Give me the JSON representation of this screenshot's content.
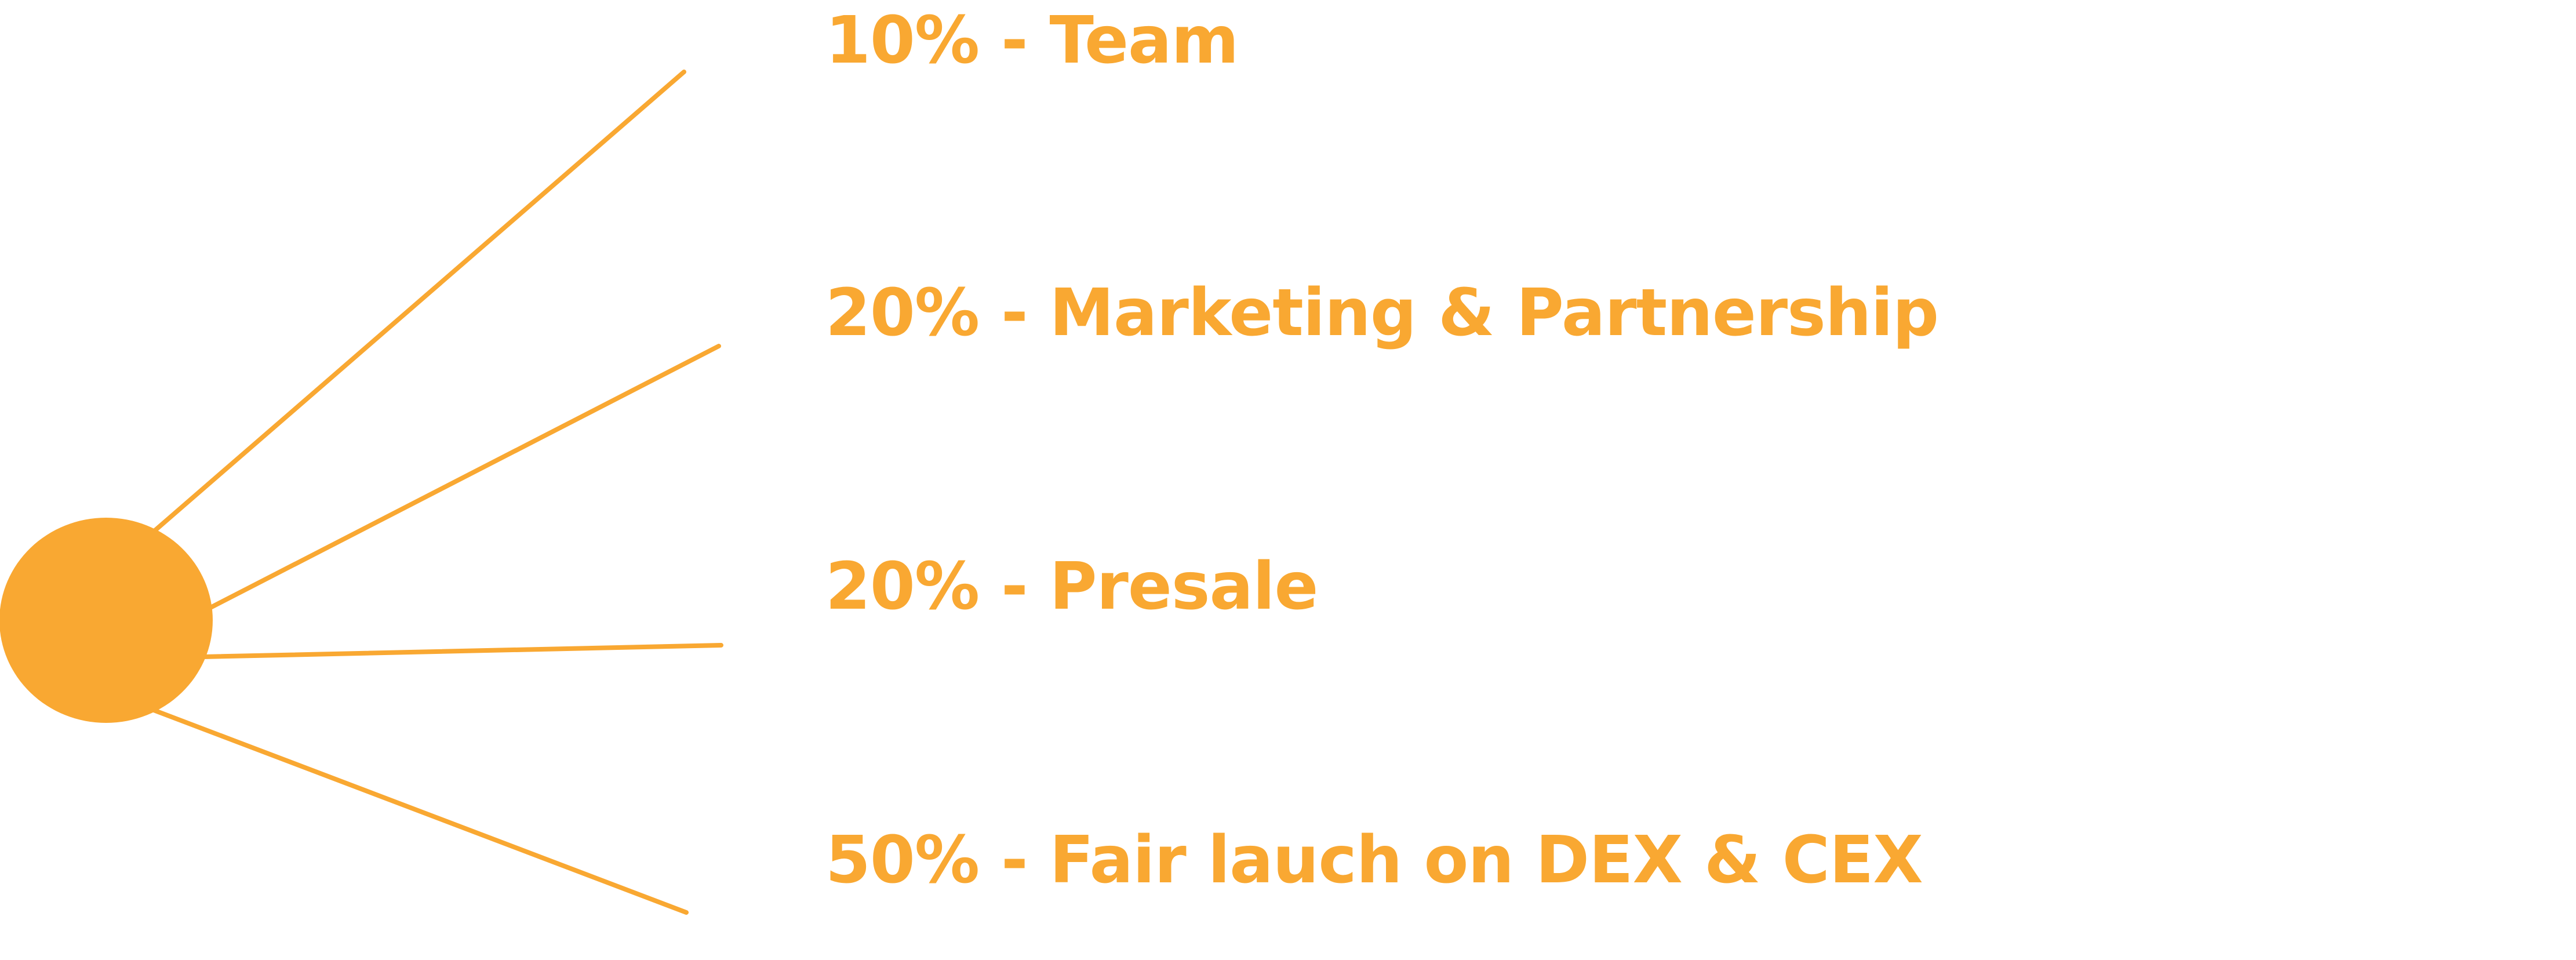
{
  "accent_color": "#F9A832",
  "allocations": [
    {
      "percent": "10%",
      "separator": "-",
      "label": "Team",
      "text": "10% - Team"
    },
    {
      "percent": "20%",
      "separator": "-",
      "label": "Marketing & Partnership",
      "text": "20% - Marketing & Partnership"
    },
    {
      "percent": "20%",
      "separator": "-",
      "label": "Presale",
      "text": "20% - Presale"
    },
    {
      "percent": "50%",
      "separator": "-",
      "label": "Fair lauch on DEX & CEX",
      "text": "50% - Fair lauch on DEX & CEX"
    }
  ]
}
